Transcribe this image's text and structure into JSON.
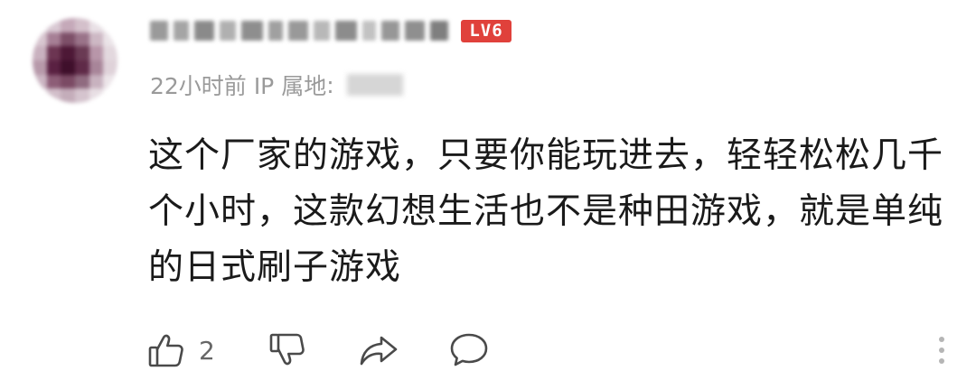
{
  "comment": {
    "level_badge": "LV6",
    "time": "22小时前",
    "ip_label": "IP 属地",
    "text": "这个厂家的游戏，只要你能玩进去，轻轻松松几千个小时，这款幻想生活也不是种田游戏，就是单纯的日式刷子游戏",
    "like_count": "2"
  },
  "colors": {
    "level_badge": "#e0413b",
    "icon_stroke": "#4a4a4a",
    "meta_text": "#9a9a9a",
    "body_text": "#1a1a1a"
  },
  "icons": [
    "thumb-up-icon",
    "thumb-down-icon",
    "share-icon",
    "comment-icon",
    "more-vertical-icon"
  ]
}
